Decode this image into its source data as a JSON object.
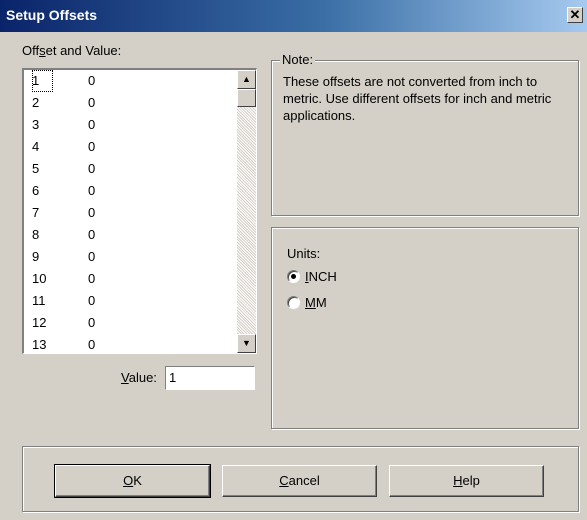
{
  "window": {
    "title": "Setup Offsets",
    "close_glyph": "✕"
  },
  "offsets": {
    "label_pre": "Off",
    "label_mnemonic": "s",
    "label_post": "et and Value:",
    "rows": [
      {
        "offset": "1",
        "value": "0"
      },
      {
        "offset": "2",
        "value": "0"
      },
      {
        "offset": "3",
        "value": "0"
      },
      {
        "offset": "4",
        "value": "0"
      },
      {
        "offset": "5",
        "value": "0"
      },
      {
        "offset": "6",
        "value": "0"
      },
      {
        "offset": "7",
        "value": "0"
      },
      {
        "offset": "8",
        "value": "0"
      },
      {
        "offset": "9",
        "value": "0"
      },
      {
        "offset": "10",
        "value": "0"
      },
      {
        "offset": "11",
        "value": "0"
      },
      {
        "offset": "12",
        "value": "0"
      },
      {
        "offset": "13",
        "value": "0"
      }
    ],
    "selected_offset": "1"
  },
  "value_field": {
    "label_mnemonic": "V",
    "label_post": "alue:",
    "value": "1"
  },
  "note": {
    "legend": "Note:",
    "text": "These offsets are not converted from inch to metric.  Use different offsets for inch and metric applications."
  },
  "units": {
    "legend": "Units:",
    "options": [
      {
        "mnemonic": "I",
        "rest": "NCH",
        "selected": true
      },
      {
        "mnemonic": "M",
        "rest": "M",
        "selected": false
      }
    ]
  },
  "buttons": {
    "ok": {
      "mnemonic": "O",
      "rest": "K"
    },
    "cancel": {
      "mnemonic": "C",
      "rest": "ancel"
    },
    "help": {
      "mnemonic": "H",
      "rest": "elp"
    }
  },
  "icons": {
    "scroll_up": "▲",
    "scroll_down": "▼"
  }
}
